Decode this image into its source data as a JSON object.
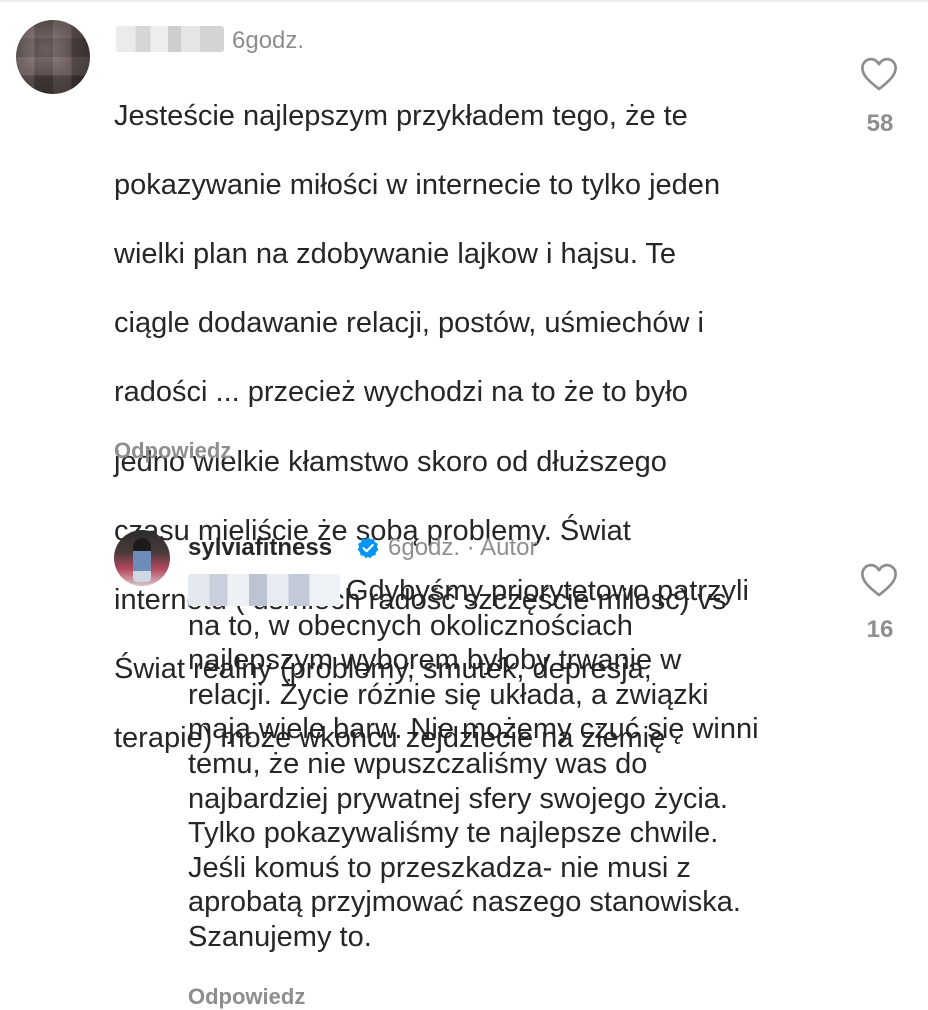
{
  "comment_1": {
    "time": "6godz.",
    "lines": [
      "Jesteście najlepszym przykładem tego, że te",
      "pokazywanie miłości w internecie to tylko jeden",
      "wielki plan na zdobywanie lajkow i hajsu. Te",
      "ciągle dodawanie relacji, postów,  uśmiechów i",
      "radości ... przecież wychodzi na to że to było",
      "jedno wielkie kłamstwo skoro od dłuższego",
      "czasu mieliście że sobą problemy.  Świat",
      "internetu ( uśmiech radość szczęście milosc)  vs",
      "Świat realny (problemy, smutek, depresja,",
      "terapie)  może wkoncu zejdziecie na ziemię"
    ],
    "likes": "58",
    "reply_label": "Odpowiedz",
    "like_icon": "heart-outline-icon"
  },
  "comment_2": {
    "username": "sylviafitness",
    "verified_icon": "verified-badge-icon",
    "time": "6godz.",
    "separator": "·",
    "author_label": "Autor",
    "lines": [
      "Gdybyśmy priorytetowo patrzyli",
      "na to, w obecnych okolicznościach",
      "najlepszym wyborem byłoby trwanie w",
      "relacji. Życie różnie się układa, a związki",
      "mają wiele barw. Nie możemy czuć się winni",
      "temu, że nie wpuszczaliśmy was do",
      "najbardziej prywatnej sfery swojego życia.",
      "Tylko pokazywaliśmy te najlepsze chwile.",
      "Jeśli komuś to przeszkadza- nie musi z",
      "aprobatą przyjmować naszego stanowiska.",
      "Szanujemy to."
    ],
    "likes": "16",
    "reply_label": "Odpowiedz",
    "like_icon": "heart-outline-icon"
  },
  "colors": {
    "text": "#262626",
    "secondary": "#8e8e8e",
    "verified": "#0095f6"
  }
}
